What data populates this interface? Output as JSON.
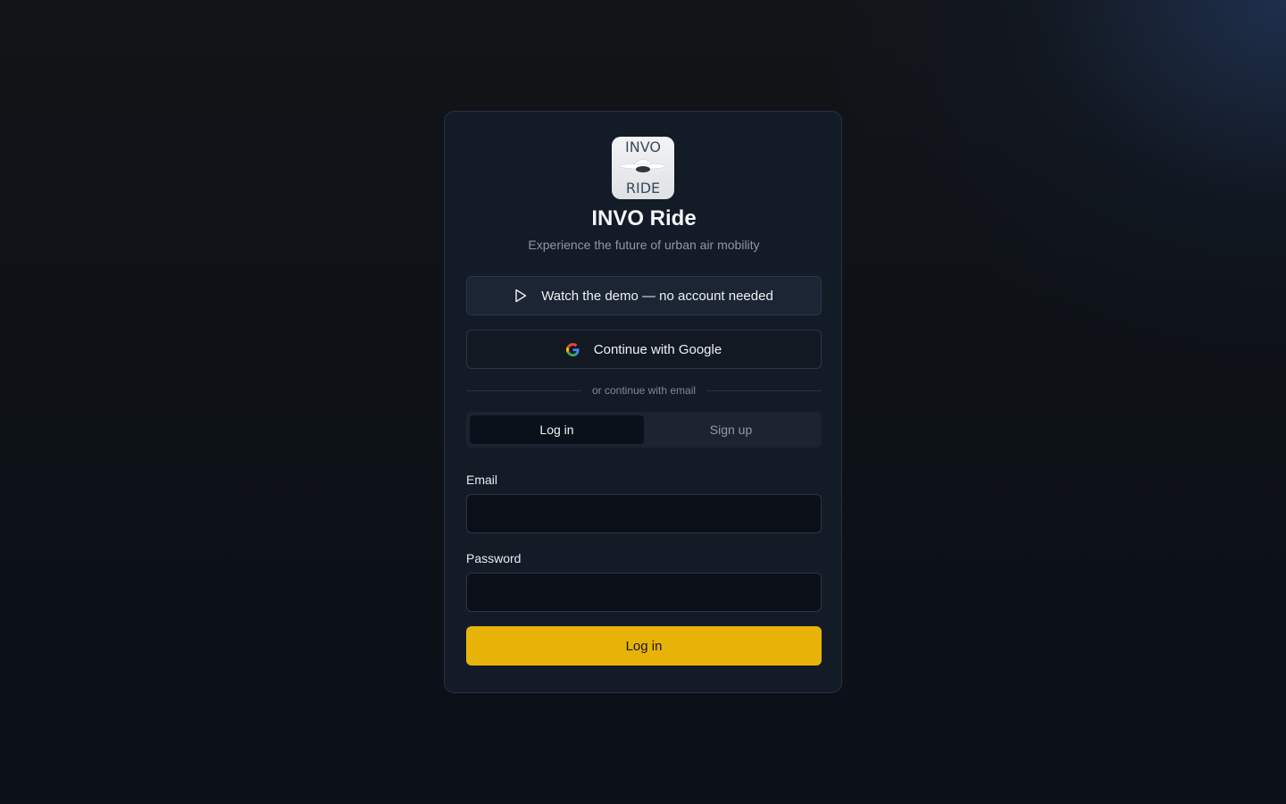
{
  "app": {
    "logo_line1": "INVO",
    "logo_line2": "RIDE",
    "title": "INVO Ride",
    "subtitle": "Experience the future of urban air mobility"
  },
  "actions": {
    "demo_label": "Watch the demo — no account needed",
    "demo_icon": "play-icon",
    "google_label": "Continue with Google",
    "google_icon": "google-icon",
    "divider_text": "or continue with email"
  },
  "tabs": [
    {
      "label": "Log in",
      "active": true
    },
    {
      "label": "Sign up",
      "active": false
    }
  ],
  "form": {
    "email_label": "Email",
    "email_value": "",
    "password_label": "Password",
    "password_value": "",
    "submit_label": "Log in"
  },
  "colors": {
    "accent": "#e8b308",
    "background": "#0b1018",
    "card": "#131b27"
  }
}
